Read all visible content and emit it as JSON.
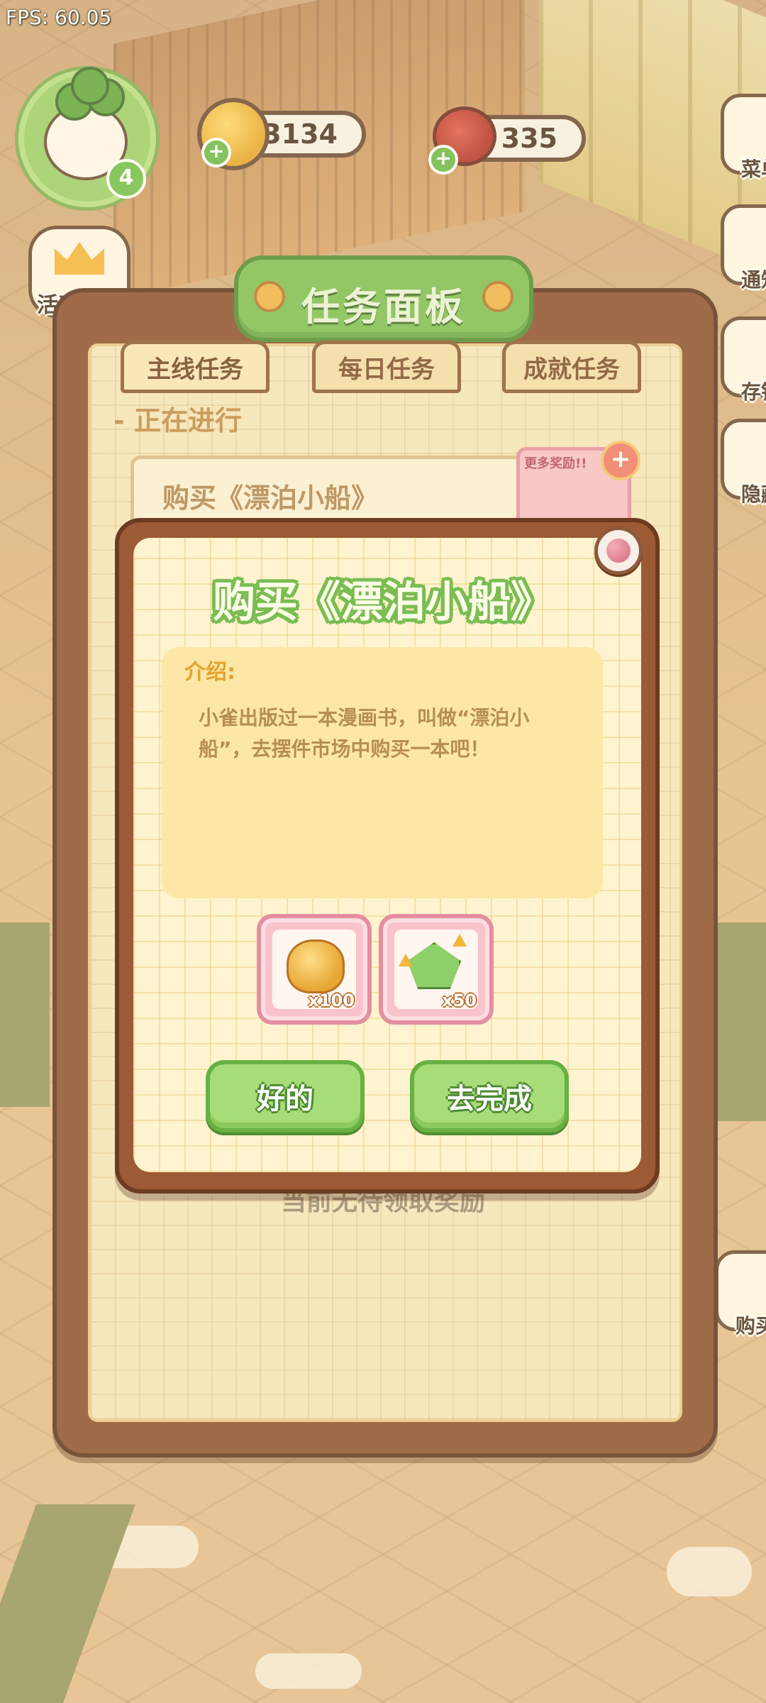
{
  "hud": {
    "fps": "FPS: 60.05",
    "player_level": "4",
    "coins": "3134",
    "cherries": "335",
    "left_buttons": [
      {
        "label": "活动汇总"
      }
    ],
    "right_buttons": [
      {
        "label": "菜单"
      },
      {
        "label": "通知"
      },
      {
        "label": "存钱"
      },
      {
        "label": "隐藏"
      },
      {
        "label": "购买"
      }
    ]
  },
  "panel": {
    "title": "任务面板",
    "tabs": [
      {
        "label": "主线任务",
        "active": true
      },
      {
        "label": "每日任务",
        "active": false
      },
      {
        "label": "成就任务",
        "active": false
      }
    ],
    "section_label": "- 正在进行",
    "current_task": "购买《漂泊小船》",
    "more_rewards_tag": "更多奖励!!",
    "empty_text": "当前无待领取奖励"
  },
  "dialog": {
    "title": "购买《漂泊小船》",
    "desc_label": "介绍:",
    "description": "小雀出版过一本漫画书，叫做“漂泊小船”，去摆件市场中购买一本吧！",
    "rewards": [
      {
        "icon": "coin-pile-icon",
        "quantity": "x100"
      },
      {
        "icon": "green-gem-upgrade-icon",
        "quantity": "x50"
      }
    ],
    "ok_button": "好的",
    "go_button": "去完成"
  },
  "colors": {
    "green_accent": "#7cbf54",
    "panel_brown": "#8a4f2f",
    "paper": "#fff4cf",
    "reward_pink": "#f9c3cc",
    "label_orange": "#e3a32e"
  }
}
